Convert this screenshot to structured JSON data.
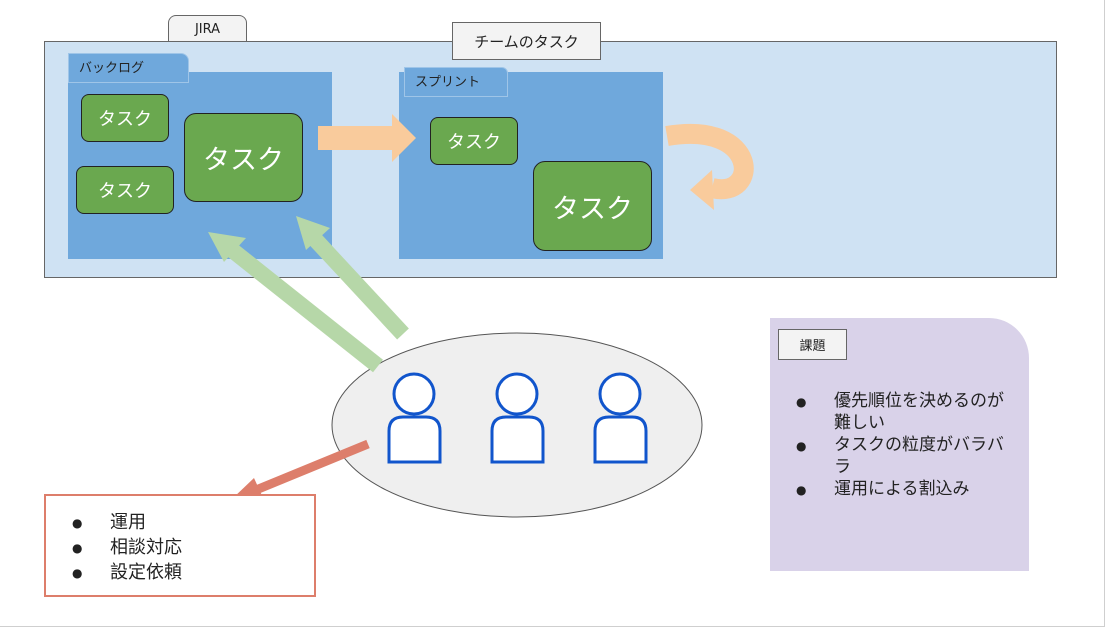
{
  "jira_tab": "JIRA",
  "team_tasks_label": "チームのタスク",
  "backlog": {
    "label": "バックログ",
    "tasks": [
      "タスク",
      "タスク",
      "タスク"
    ]
  },
  "sprint": {
    "label": "スプリント",
    "tasks": [
      "タスク",
      "タスク"
    ]
  },
  "issues": {
    "label": "課題",
    "items": [
      "優先順位を決めるのが難しい",
      "タスクの粒度がバラバラ",
      "運用による割込み"
    ]
  },
  "requests": {
    "items": [
      "運用",
      "相談対応",
      "設定依頼"
    ]
  },
  "colors": {
    "team_area": "#cfe2f3",
    "panel": "#6fa8dc",
    "task": "#6aa84f",
    "arrow_orange": "#f9cb9c",
    "arrow_green": "#b6d7a8",
    "arrow_red": "#dd7e6b",
    "people": "#1155cc",
    "issue_card": "#d9d2e9"
  }
}
